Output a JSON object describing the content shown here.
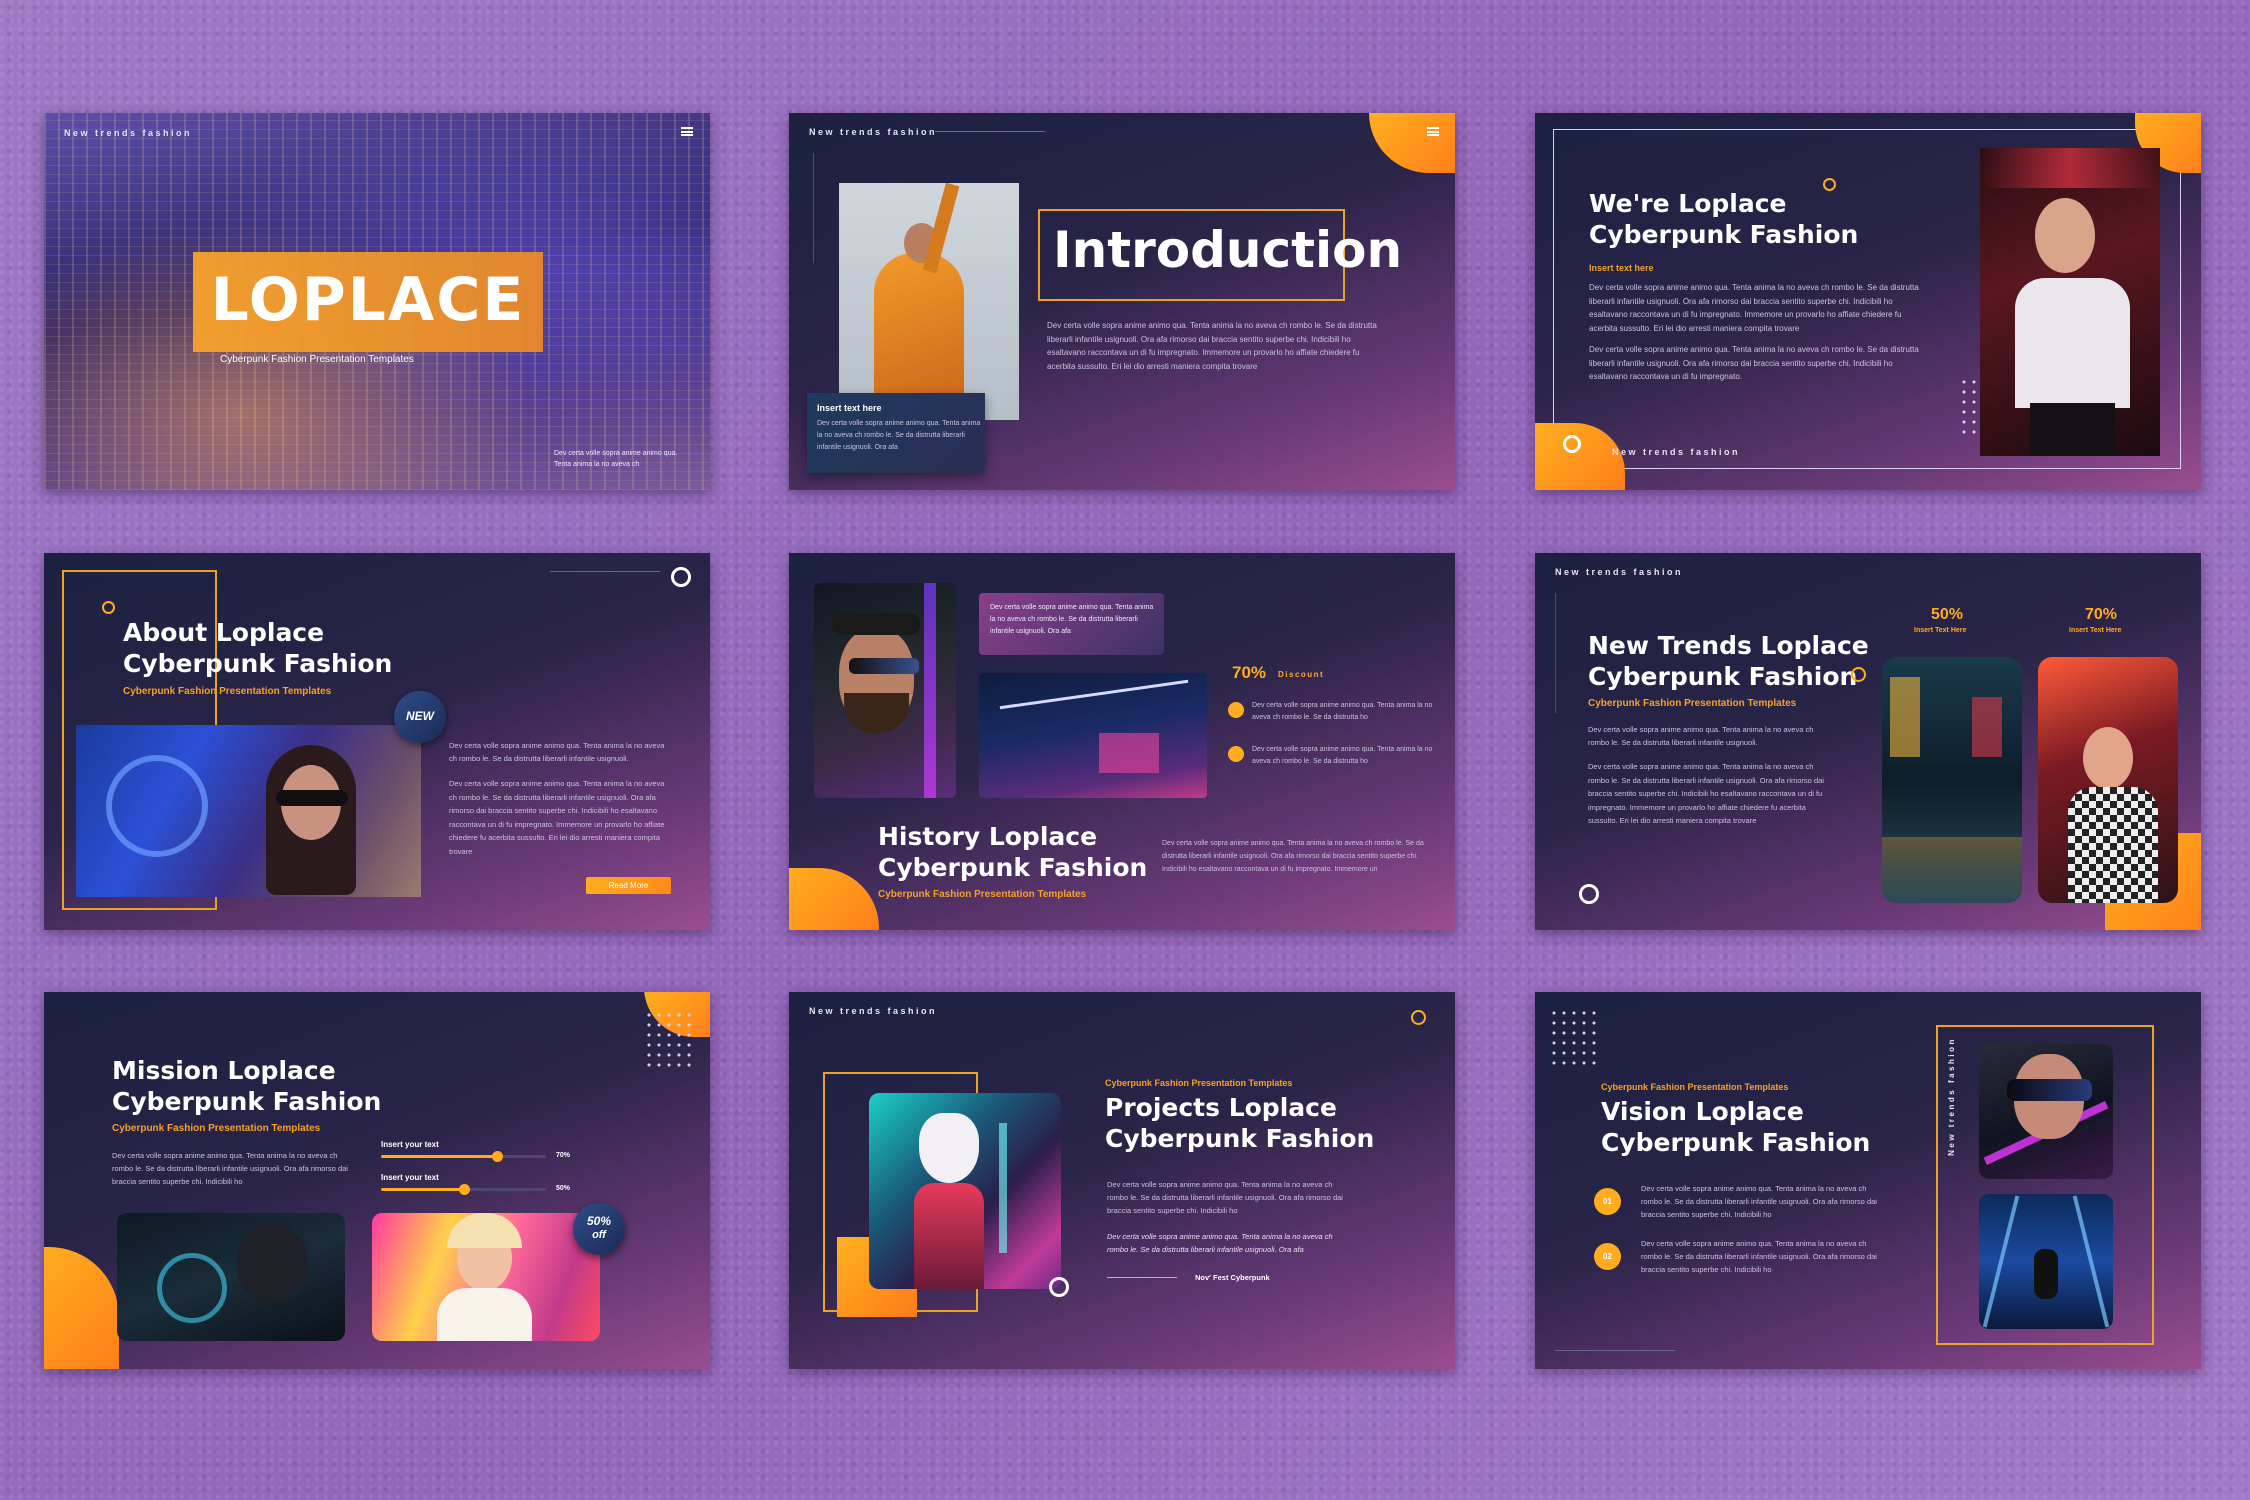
{
  "brand": "New trends fashion",
  "lorem_short": "Dev certa volle sopra anime animo qua. Tenta anima la no aveva ch rombo le. Se da distrutta liberarli infantile usignuoli.",
  "lorem_long": "Dev certa volle sopra anime animo qua. Tenta anima la no aveva ch rombo le. Se da distrutta liberarli infantile usignuoli. Ora afa rimorso dai braccia sentito superbe chi. Indicibili ho esaltavano raccontava un di fu impregnato. Immemore un provarlo ho affiate chiedere fu acerbita sussulto. Eri lei dio arresti maniera compita trovare",
  "cover": {
    "title": "LOPLACE",
    "subtitle": "Cyberpunk Fashion Presentation Templates",
    "corner_text": "Dev certa volle sopra anime animo qua. Tenta anima la no aveva ch"
  },
  "intro": {
    "title": "Introduction",
    "body": "Dev certa volle sopra anime animo qua. Tenta anima la no aveva ch rombo le. Se da distrutta liberarli infantile usignuoli. Ora afa rimorso dai braccia sentito superbe chi. Indicibili ho esaltavano raccontava un di fu impregnato. Immemore un provarlo ho affiate chiedere fu acerbita sussulto. Eri lei dio arresti maniera compita trovare",
    "card_title": "Insert text here",
    "card_body": "Dev certa volle sopra anime animo qua. Tenta anima la no aveva ch rombo le. Se da distrutta liberarli infantile usignuoli. Ora afa"
  },
  "were": {
    "title1": "We're Loplace",
    "title2": "Cyberpunk Fashion",
    "sub": "Insert text here",
    "body1": "Dev certa volle sopra anime animo qua. Tenta anima la no aveva ch rombo le. Se da distrutta liberarli infantile usignuoli. Ora afa rimorso dai braccia sentito superbe chi. Indicibili ho esaltavano raccontava un di fu impregnato. Immemore un provarlo ho affiate chiedere fu acerbita sussulto. Eri lei dio arresti maniera compita trovare",
    "body2": "Dev certa volle sopra anime animo qua. Tenta anima la no aveva ch rombo le. Se da distrutta liberarli infantile usignuoli. Ora afa rimorso dai braccia sentito superbe chi. Indicibili ho esaltavano raccontava un di fu impregnato."
  },
  "about": {
    "title1": "About Loplace",
    "title2": "Cyberpunk Fashion",
    "sub": "Cyberpunk Fashion Presentation Templates",
    "badge": "NEW",
    "body1": "Dev certa volle sopra anime animo qua. Tenta anima la no aveva ch rombo le. Se da distrutta liberarli infantile usignuoli.",
    "body2": "Dev certa volle sopra anime animo qua. Tenta anima la no aveva ch rombo le. Se da distrutta liberarli infantile usignuoli. Ora afa rimorso dai braccia sentito superbe chi. Indicibili ho esaltavano raccontava un di fu impregnato. Immemore un provarlo ho affiate chiedere fu acerbita sussulto. Eri lei dio arresti maniera compita trovare",
    "button": "Read More"
  },
  "history": {
    "title1": "History Loplace",
    "title2": "Cyberpunk Fashion",
    "sub": "Cyberpunk Fashion Presentation Templates",
    "card": "Dev certa volle sopra anime animo qua. Tenta anima la no aveva ch rombo le. Se da distrutta liberarli infantile usignuoli. Ora afa",
    "percent": "70%",
    "percent_label": "Discount",
    "item1": "Dev certa volle sopra anime animo qua. Tenta anima la no aveva ch rombo le. Se da distrutta ho",
    "item2": "Dev certa volle sopra anime animo qua. Tenta anima la no aveva ch rombo le. Se da distrutta ho",
    "body": "Dev certa volle sopra anime animo qua. Tenta anima la no aveva ch rombo le. Se da distrutta liberarli infantile usignuoli. Ora afa rimorso dai braccia sentito superbe chi. Indicibili ho esaltavano raccontava un di fu impregnato. Immemore un"
  },
  "trends": {
    "title1": "New Trends Loplace",
    "title2": "Cyberpunk Fashion",
    "sub": "Cyberpunk Fashion Presentation Templates",
    "body1": "Dev certa volle sopra anime animo qua. Tenta anima la no aveva ch rombo le. Se da distrutta liberarli infantile usignuoli.",
    "body2": "Dev certa volle sopra anime animo qua. Tenta anima la no aveva ch rombo le. Se da distrutta liberarli infantile usignuoli. Ora afa rimorso dai braccia sentito superbe chi. Indicibili ho esaltavano raccontava un di fu impregnato. Immemore un provarlo ho affiate chiedere fu acerbita sussulto. Eri lei dio arresti maniera compita trovare",
    "stat1_value": "50%",
    "stat1_label": "Insert Text Here",
    "stat2_value": "70%",
    "stat2_label": "Insert Text Here"
  },
  "mission": {
    "title1": "Mission Loplace",
    "title2": "Cyberpunk Fashion",
    "sub": "Cyberpunk Fashion Presentation Templates",
    "body": "Dev certa volle sopra anime animo qua. Tenta anima la no aveva ch rombo le. Se da distrutta liberarli infantile usignuoli. Ora afa rimorso dai braccia sentito superbe chi. Indicibili ho",
    "bar1_label": "Insert your text",
    "bar1_value": "70%",
    "bar1_fraction": 0.7,
    "bar2_label": "Insert your text",
    "bar2_value": "50%",
    "bar2_fraction": 0.5,
    "sale_pct": "50%",
    "sale_off": "off"
  },
  "projects": {
    "sub": "Cyberpunk Fashion Presentation Templates",
    "title1": "Projects Loplace",
    "title2": "Cyberpunk Fashion",
    "body": "Dev certa volle sopra anime animo qua. Tenta anima la no aveva ch rombo le. Se da distrutta liberarli infantile usignuoli. Ora afa rimorso dai braccia sentito superbe chi. Indicibili ho",
    "quote": "Dev certa volle sopra anime animo qua. Tenta anima la no aveva ch rombo le. Se da distrutta liberarli infantile usignuoli. Ora afa",
    "signature": "Nov' Fest Cyberpunk"
  },
  "vision": {
    "sub": "Cyberpunk Fashion Presentation Templates",
    "title1": "Vision Loplace",
    "title2": "Cyberpunk Fashion",
    "n1": "01",
    "n2": "02",
    "item1": "Dev certa volle sopra anime animo qua. Tenta anima la no aveva ch rombo le. Se da distrutta liberarli infantile usignuoli. Ora afa rimorso dai braccia sentito superbe chi. Indicibili ho",
    "item2": "Dev certa volle sopra anime animo qua. Tenta anima la no aveva ch rombo le. Se da distrutta liberarli infantile usignuoli. Ora afa rimorso dai braccia sentito superbe chi. Indicibili ho"
  },
  "colors": {
    "accent": "#ffad1f",
    "bg_dark": "#1c2140",
    "bg_pink": "#9a4d8e",
    "canvas": "#9a6fbf"
  }
}
